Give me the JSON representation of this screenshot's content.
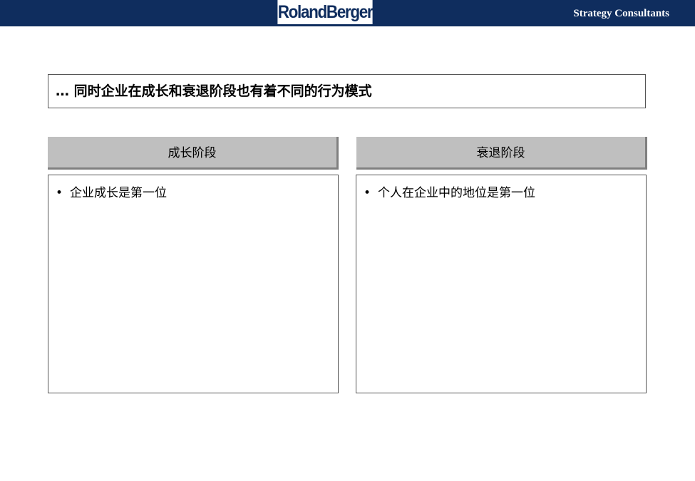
{
  "header": {
    "logo_text": "RolandBerger",
    "tagline": "Strategy Consultants"
  },
  "headline": "… 同时企业在成长和衰退阶段也有着不同的行为模式",
  "columns": [
    {
      "title": "成长阶段",
      "bullets": [
        "企业成长是第一位"
      ]
    },
    {
      "title": "衰退阶段",
      "bullets": [
        "个人在企业中的地位是第一位"
      ]
    }
  ],
  "colors": {
    "brand_navy": "#0f2d5e",
    "header_gray": "#bfbfbf",
    "header_shadow": "#808080"
  }
}
